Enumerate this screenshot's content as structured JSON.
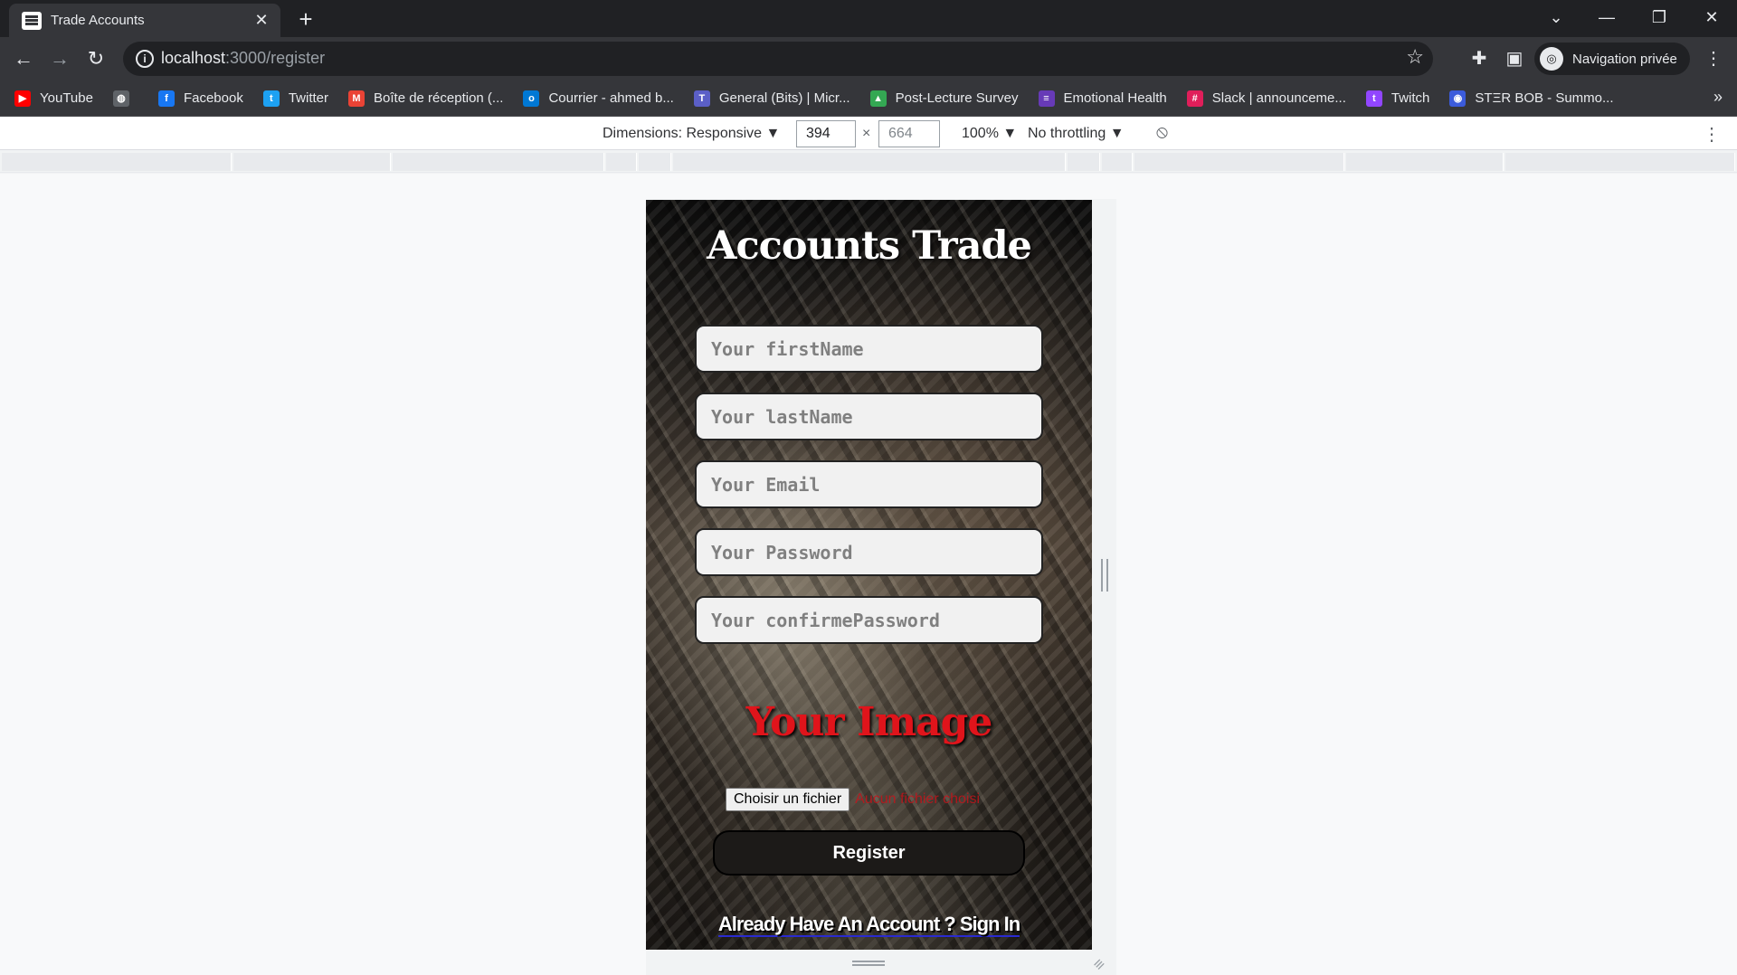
{
  "tab": {
    "title": "Trade Accounts",
    "close": "✕",
    "new_tab": "+"
  },
  "window_controls": {
    "tab_search": "⌄",
    "minimize": "—",
    "restore": "❐",
    "close": "✕"
  },
  "toolbar": {
    "back": "←",
    "forward": "→",
    "reload": "↻",
    "url_host": "localhost",
    "url_path": ":3000/register",
    "star": "☆",
    "extensions": "✚",
    "sidepanel": "▣",
    "profile_label": "Navigation privée",
    "profile_icon": "◎",
    "menu": "⋮"
  },
  "bookmarks": [
    {
      "label": "YouTube",
      "color": "#ff0000",
      "glyph": "▶"
    },
    {
      "label": "",
      "color": "#5f6368",
      "glyph": "◍"
    },
    {
      "label": "Facebook",
      "color": "#1877f2",
      "glyph": "f"
    },
    {
      "label": "Twitter",
      "color": "#1da1f2",
      "glyph": "t"
    },
    {
      "label": "Boîte de réception (...",
      "color": "#ea4335",
      "glyph": "M"
    },
    {
      "label": "Courrier - ahmed b...",
      "color": "#0078d4",
      "glyph": "o"
    },
    {
      "label": "General (Bits) | Micr...",
      "color": "#5b5fc7",
      "glyph": "T"
    },
    {
      "label": "Post-Lecture Survey",
      "color": "#34a853",
      "glyph": "▲"
    },
    {
      "label": "Emotional Health",
      "color": "#673ab7",
      "glyph": "≡"
    },
    {
      "label": "Slack | announceme...",
      "color": "#e01e5a",
      "glyph": "#"
    },
    {
      "label": "Twitch",
      "color": "#9146ff",
      "glyph": "t"
    },
    {
      "label": "STΞR BOB - Summo...",
      "color": "#3b5bdb",
      "glyph": "◉"
    }
  ],
  "bookmarks_more": "»",
  "devtools": {
    "dimensions_label": "Dimensions: Responsive ▼",
    "width": "394",
    "height": "664",
    "times": "×",
    "zoom": "100% ▼",
    "throttling": "No throttling ▼",
    "rotate": "⦸",
    "menu": "⋮"
  },
  "page": {
    "title": "Accounts Trade",
    "fields": [
      {
        "placeholder": "Your firstName"
      },
      {
        "placeholder": "Your lastName"
      },
      {
        "placeholder": "Your Email"
      },
      {
        "placeholder": "Your Password"
      },
      {
        "placeholder": "Your confirmePassword"
      }
    ],
    "image_heading": "Your Image",
    "file_button": "Choisir un fichier",
    "file_status": "Aucun fichier choisi",
    "register_button": "Register",
    "signin_link": "Already Have An Account ? Sign In"
  }
}
